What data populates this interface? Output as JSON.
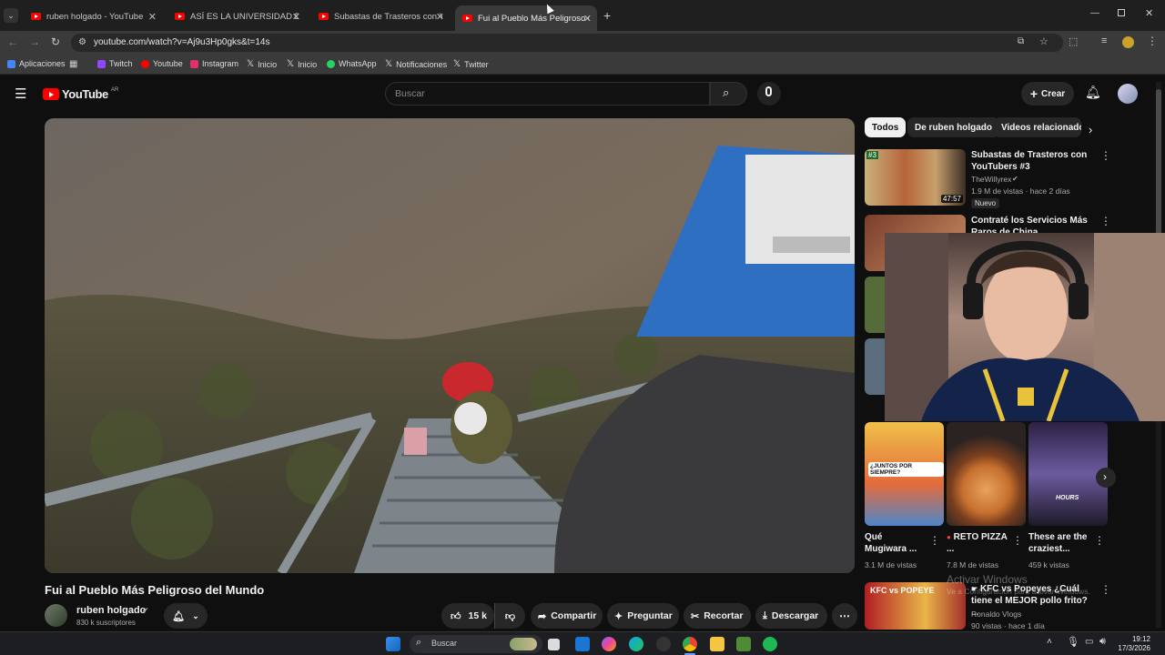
{
  "browser": {
    "tabs": [
      {
        "label": "ruben holgado - YouTube",
        "active": false
      },
      {
        "label": "ASÍ ES LA UNIVERSIDAD DEL F",
        "active": false
      },
      {
        "label": "Subastas de Trasteros con You",
        "active": false
      },
      {
        "label": "Fui al Pueblo Más Peligroso del",
        "active": true
      }
    ],
    "new_tab": "+",
    "url": "youtube.com/watch?v=Aj9u3Hp0gks&t=14s",
    "bookmarks": [
      {
        "label": "Aplicaciones",
        "color": "#4285f4"
      },
      {
        "label": "Twitch",
        "color": "#9146ff"
      },
      {
        "label": "Youtube",
        "color": "#ff0000"
      },
      {
        "label": "Instagram",
        "color": "#e1306c"
      },
      {
        "label": "Inicio",
        "color": "#ffffff"
      },
      {
        "label": "Inicio",
        "color": "#ffffff"
      },
      {
        "label": "WhatsApp",
        "color": "#25d366"
      },
      {
        "label": "Notificaciones",
        "color": "#ffffff"
      },
      {
        "label": "Twitter",
        "color": "#ffffff"
      }
    ]
  },
  "youtube": {
    "logo_text": "YouTube",
    "country": "AR",
    "search_placeholder": "Buscar",
    "create_label": "Crear",
    "chips": [
      "Todos",
      "De ruben holgado",
      "Videos relacionado"
    ]
  },
  "video": {
    "title": "Fui al Pueblo Más Peligroso del Mundo",
    "channel": "ruben holgado",
    "subscribers": "830 k suscriptores",
    "likes": "15 k",
    "actions": [
      "Compartir",
      "Preguntar",
      "Recortar",
      "Descargar"
    ]
  },
  "recommendations": [
    {
      "title": "Subastas de Trasteros con YouTubers #3",
      "channel": "TheWillyrex",
      "meta": "1.9 M de vistas · hace 2 días",
      "badge": "Nuevo",
      "duration": "47:57",
      "rank": "#3"
    },
    {
      "title": "Contraté los Servicios Más Raros de China",
      "channel": "",
      "meta": "",
      "badge": "",
      "duration": "",
      "rank": ""
    }
  ],
  "shorts": [
    {
      "title": "Qué Mugiwara ...",
      "meta": "3.1 M de vistas",
      "thumb_text": "¿JUNTOS POR SIEMPRE?"
    },
    {
      "title": "RETO PIZZA ...",
      "meta": "7.8 M de vistas",
      "thumb_text": ""
    },
    {
      "title": "These are the craziest...",
      "meta": "459 k vistas",
      "thumb_text": "HOURS"
    }
  ],
  "rec_bottom": {
    "title": "KFC vs Popeyes ¿Cuál tiene el MEJOR pollo frito? ...",
    "channel": "Ronaldo Vlogs",
    "meta": "90 vistas · hace 1 día",
    "thumb_text": "KFC vs POPEYE"
  },
  "watermark": {
    "line1": "Activar Windows",
    "line2": "Ve a Configuración para activar Windows."
  },
  "taskbar": {
    "search_placeholder": "Buscar",
    "time": "19:12",
    "date": "17/3/2026"
  }
}
